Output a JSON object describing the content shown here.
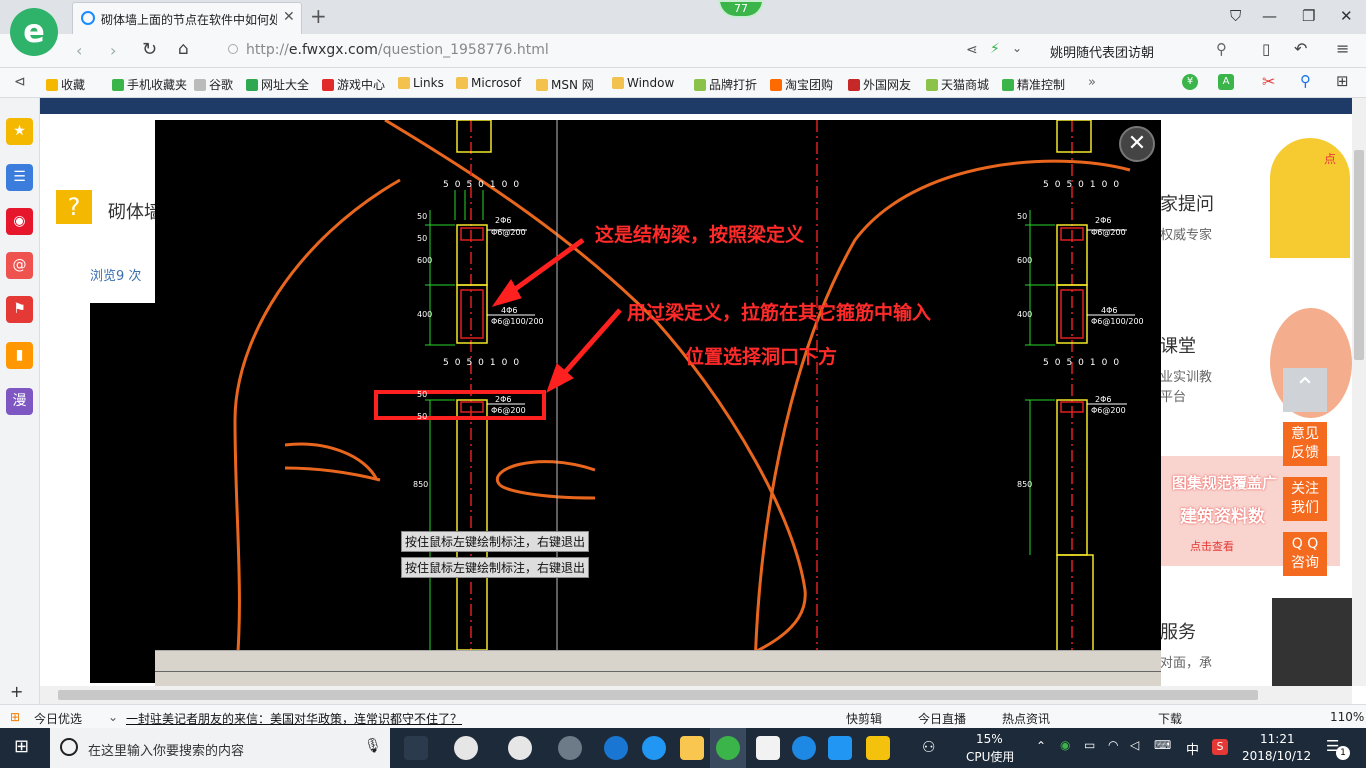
{
  "browser": {
    "logo_glyph": "e",
    "tab_title": "砌体墙上面的节点在软件中如何处",
    "badge": "77",
    "url_prefix": "http://",
    "url_host": "e.fwxgx.com",
    "url_path": "/question_1958776.html",
    "search_text": "姚明随代表团访朝"
  },
  "bookmarks": [
    {
      "label": "收藏",
      "color": "#f5b800"
    },
    {
      "label": "手机收藏夹",
      "color": "#3bb54a"
    },
    {
      "label": "谷歌",
      "color": "#bbbbbb"
    },
    {
      "label": "网址大全",
      "color": "#2fa84f"
    },
    {
      "label": "游戏中心",
      "color": "#e12b2b"
    },
    {
      "label": "Links",
      "color": "#f2c14e"
    },
    {
      "label": "Microsof",
      "color": "#f2c14e"
    },
    {
      "label": "MSN 网",
      "color": "#f2c14e"
    },
    {
      "label": "Window",
      "color": "#f2c14e"
    },
    {
      "label": "品牌打折",
      "color": "#8bc34a"
    },
    {
      "label": "淘宝团购",
      "color": "#ff6a00"
    },
    {
      "label": "外国网友",
      "color": "#c62828"
    },
    {
      "label": "天猫商城",
      "color": "#8bc34a"
    },
    {
      "label": "精准控制",
      "color": "#3bb54a"
    }
  ],
  "sidebar_icons": [
    {
      "name": "favorites-star-icon",
      "glyph": "★",
      "color": "#f5b800"
    },
    {
      "name": "news-feed-icon",
      "glyph": "☰",
      "color": "#3b7ddd"
    },
    {
      "name": "weibo-icon",
      "glyph": "◉",
      "color": "#e6162d"
    },
    {
      "name": "mail-icon",
      "glyph": "@",
      "color": "#ef5350"
    },
    {
      "name": "game-icon",
      "glyph": "⚑",
      "color": "#e53935"
    },
    {
      "name": "reading-icon",
      "glyph": "▮",
      "color": "#ff9800"
    },
    {
      "name": "comic-icon",
      "glyph": "漫",
      "color": "#7e57c2"
    }
  ],
  "page": {
    "question_title": "砌体墙",
    "views": "浏览9 次",
    "right_items": [
      "家提问",
      "权威专家",
      "课堂",
      "业实训教",
      "平台",
      "图集规范覆盖广",
      "建筑资料数",
      "点击查看",
      "服务",
      "对面，承",
      "点"
    ],
    "float_buttons": [
      "意见\n反馈",
      "关注\n我们",
      "Q Q\n咨询"
    ]
  },
  "annotations": {
    "note1": "这是结构梁，按照梁定义",
    "note2": "用过梁定义，拉筋在其它箍筋中输入",
    "note3": "位置选择洞口下方",
    "prompt1": "按住鼠标左键绘制标注，右键退出",
    "prompt2": "按住鼠标左键绘制标注，右键退出",
    "dims_top": [
      "50",
      "50",
      "100"
    ],
    "dims_left": [
      "50",
      "50",
      "600",
      "400"
    ],
    "rebar1": "2Φ6",
    "stirrup1": "Φ6@200",
    "rebar2": "4Φ6",
    "stirrup2": "Φ6@100/200",
    "dims_lower": [
      "50",
      "50",
      "100"
    ],
    "dims_lower_left": [
      "50",
      "50",
      "850"
    ]
  },
  "statusbar": {
    "left1": "今日优选",
    "news": "一封驻美记者朋友的来信：美国对华政策，连常识都守不住了？",
    "items": [
      "快剪辑",
      "今日直播",
      "热点资讯",
      "下载"
    ],
    "zoom": "110%"
  },
  "taskbar": {
    "search_placeholder": "在这里输入你要搜索的内容",
    "cpu_percent": "15%",
    "cpu_label": "CPU使用",
    "ime": "中",
    "time": "11:21",
    "date": "2018/10/12",
    "notif": "1"
  }
}
